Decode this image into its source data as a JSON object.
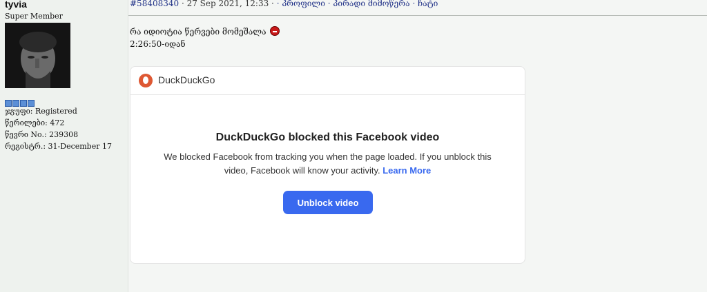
{
  "user": {
    "name": "tyvia",
    "rank": "Super Member",
    "group": "ჯგუფი: Registered",
    "posts": "წერილები: 472",
    "member_no": "წევრი No.: 239308",
    "registered": "რეგისტრ.: 31-December 17"
  },
  "post": {
    "id": "#58408340",
    "date": " · 27 Sep 2021, 12:33 · ",
    "links": [
      " · პროფილი",
      " · პირადი მიმოწერა",
      " · ჩატი"
    ],
    "message_line1": "რა იდიოტია წერვები მომეშალა",
    "message_line2": "2:26:50-იდან"
  },
  "card": {
    "brand": "DuckDuckGo",
    "title": "DuckDuckGo blocked this Facebook video",
    "body": "We blocked Facebook from tracking you when the page loaded. If you unblock this video, Facebook will know your activity. ",
    "learn_more": "Learn More",
    "button": "Unblock video"
  },
  "colors": {
    "accent": "#3969ef",
    "ddg": "#de5833"
  }
}
